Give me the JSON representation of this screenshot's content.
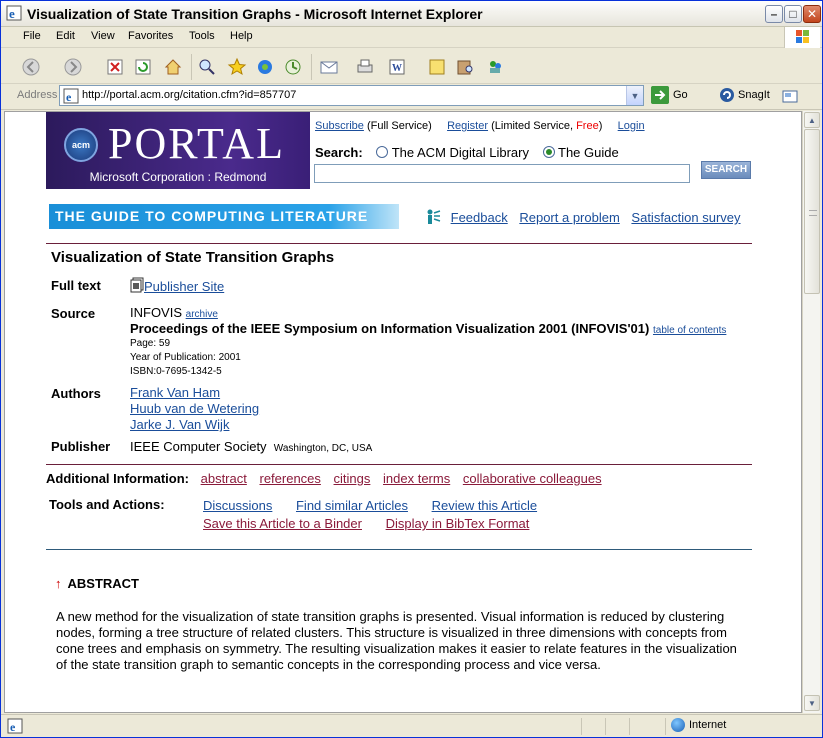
{
  "window": {
    "title": "Visualization of State Transition Graphs - Microsoft Internet Explorer"
  },
  "menu": [
    "File",
    "Edit",
    "View",
    "Favorites",
    "Tools",
    "Help"
  ],
  "address": {
    "label": "Address",
    "url": "http://portal.acm.org/citation.cfm?id=857707",
    "go_label": "Go",
    "snagit_label": "SnagIt"
  },
  "status": {
    "zone": "Internet"
  },
  "portal": {
    "logo_text": "PORTAL",
    "acm_badge": "acm",
    "org_line": "Microsoft Corporation : Redmond",
    "subscribe": "Subscribe",
    "subscribe_note": "(Full Service)",
    "register": "Register",
    "register_note": "(Limited Service,",
    "free": "Free",
    "close_paren": ")",
    "login": "Login",
    "search_label": "Search:",
    "option_dl": "The ACM Digital Library",
    "option_guide": "The Guide",
    "search_button": "SEARCH",
    "guide_banner": "THE GUIDE TO COMPUTING LITERATURE",
    "feedback": "Feedback",
    "report": "Report a problem",
    "survey": "Satisfaction survey"
  },
  "article": {
    "title": "Visualization of State Transition Graphs",
    "fulltext_label": "Full text",
    "publisher_site": "Publisher Site",
    "source_label": "Source",
    "source_name": "INFOVIS",
    "archive": "archive",
    "proceedings": "Proceedings of the IEEE Symposium on Information Visualization 2001 (INFOVIS'01)",
    "toc": "table of contents",
    "page": "Page: 59",
    "year": "Year of Publication: 2001",
    "isbn": "ISBN:0-7695-1342-5",
    "authors_label": "Authors",
    "authors": [
      "Frank Van Ham",
      "Huub van de Wetering",
      "Jarke J. Van Wijk"
    ],
    "publisher_label": "Publisher",
    "publisher": "IEEE Computer Society",
    "publisher_loc": "Washington, DC, USA"
  },
  "additional": {
    "label": "Additional Information:",
    "links": [
      "abstract",
      "references",
      "citings",
      "index terms",
      "collaborative colleagues"
    ]
  },
  "tools": {
    "label": "Tools and Actions:",
    "links1": [
      "Discussions",
      "Find similar Articles",
      "Review this Article"
    ],
    "links2": [
      "Save this Article to a Binder",
      "Display in BibTex Format"
    ]
  },
  "abstract": {
    "heading": "ABSTRACT",
    "text": "A new method for the visualization of state transition graphs is presented. Visual information is reduced by clustering nodes, forming a tree structure of related clusters. This structure is visualized in three dimensions with concepts from cone trees and emphasis on symmetry. The resulting visualization makes it easier to relate features in the visualization of the state transition graph to semantic concepts in the corresponding process and vice versa."
  },
  "colors": {
    "titlebar": "#ece9d8",
    "guide_banner": "#1a8fd8",
    "link": "#1a4d9a",
    "visited": "#8a1a3a"
  }
}
